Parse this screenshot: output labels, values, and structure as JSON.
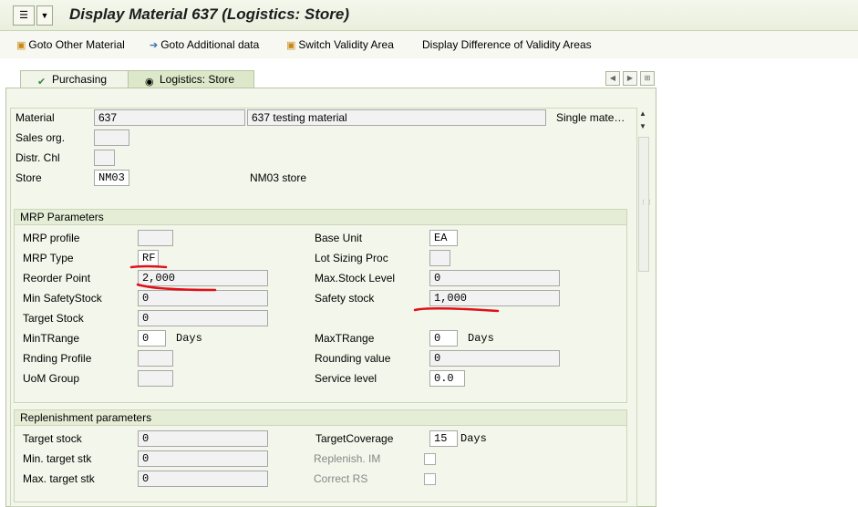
{
  "window": {
    "title": "Display Material 637 (Logistics: Store)"
  },
  "toolbar": {
    "goto_other": "Goto Other Material",
    "goto_additional": "Goto Additional data",
    "switch_validity": "Switch Validity Area",
    "display_difference": "Display Difference of Validity Areas"
  },
  "tabs": [
    {
      "label": "Purchasing",
      "icon": "check-icon",
      "active": false
    },
    {
      "label": "Logistics: Store",
      "icon": "radio-icon",
      "active": true
    }
  ],
  "header": {
    "material_label": "Material",
    "material_value": "637",
    "material_desc": "637 testing material",
    "material_type": "Single mate…",
    "sales_org_label": "Sales org.",
    "sales_org_value": "",
    "distr_chl_label": "Distr. Chl",
    "distr_chl_value": "",
    "store_label": "Store",
    "store_value": "NM03",
    "store_desc": "NM03 store"
  },
  "mrp": {
    "title": "MRP Parameters",
    "mrp_profile_label": "MRP profile",
    "mrp_profile_value": "",
    "mrp_type_label": "MRP Type",
    "mrp_type_value": "RF",
    "reorder_point_label": "Reorder Point",
    "reorder_point_value": "2,000",
    "min_safety_label": "Min SafetyStock",
    "min_safety_value": "0",
    "target_stock_label": "Target Stock",
    "target_stock_value": "0",
    "min_trange_label": "MinTRange",
    "min_trange_value": "0",
    "min_trange_unit": "Days",
    "rnding_profile_label": "Rnding Profile",
    "rnding_profile_value": "",
    "uom_group_label": "UoM Group",
    "uom_group_value": "",
    "base_unit_label": "Base Unit",
    "base_unit_value": "EA",
    "lot_sizing_label": "Lot Sizing Proc",
    "lot_sizing_value": "",
    "max_stock_label": "Max.Stock Level",
    "max_stock_value": "0",
    "safety_stock_label": "Safety stock",
    "safety_stock_value": "1,000",
    "max_trange_label": "MaxTRange",
    "max_trange_value": "0",
    "max_trange_unit": "Days",
    "rounding_value_label": "Rounding value",
    "rounding_value_value": "0",
    "service_level_label": "Service level",
    "service_level_value": "0.0"
  },
  "replenishment": {
    "title": "Replenishment parameters",
    "target_stock_label": "Target stock",
    "target_stock_value": "0",
    "min_target_label": "Min. target stk",
    "min_target_value": "0",
    "max_target_label": "Max. target stk",
    "max_target_value": "0",
    "target_coverage_label": "TargetCoverage",
    "target_coverage_value": "15",
    "target_coverage_unit": "Days",
    "replenish_im_label": "Replenish. IM",
    "replenish_im_checked": false,
    "correct_rs_label": "Correct RS",
    "correct_rs_checked": false
  },
  "colors": {
    "annotation": "#e0101a",
    "title_bg": "#eef3e4",
    "group_header": "#e6edd7"
  }
}
